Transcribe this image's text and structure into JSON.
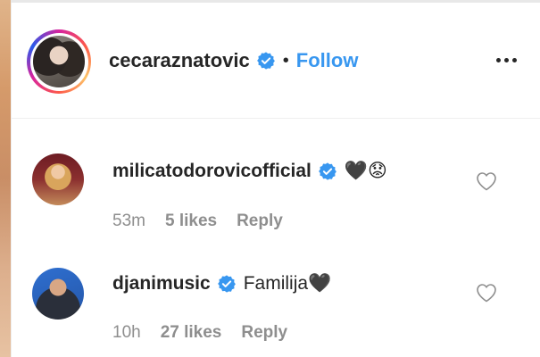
{
  "header": {
    "username": "cecaraznatovic",
    "separator": "•",
    "follow_label": "Follow",
    "more_icon": "more-horizontal-icon"
  },
  "comments": [
    {
      "username": "milicatodorovicofficial",
      "text": "🖤😟",
      "time": "53m",
      "likes": "5 likes",
      "reply_label": "Reply"
    },
    {
      "username": "djanimusic",
      "text": "Familija🖤",
      "time": "10h",
      "likes": "27 likes",
      "reply_label": "Reply"
    }
  ],
  "colors": {
    "accent_blue": "#3897f0",
    "text_primary": "#262626",
    "text_secondary": "#8e8e8e",
    "verified_badge": "#3897f0"
  }
}
